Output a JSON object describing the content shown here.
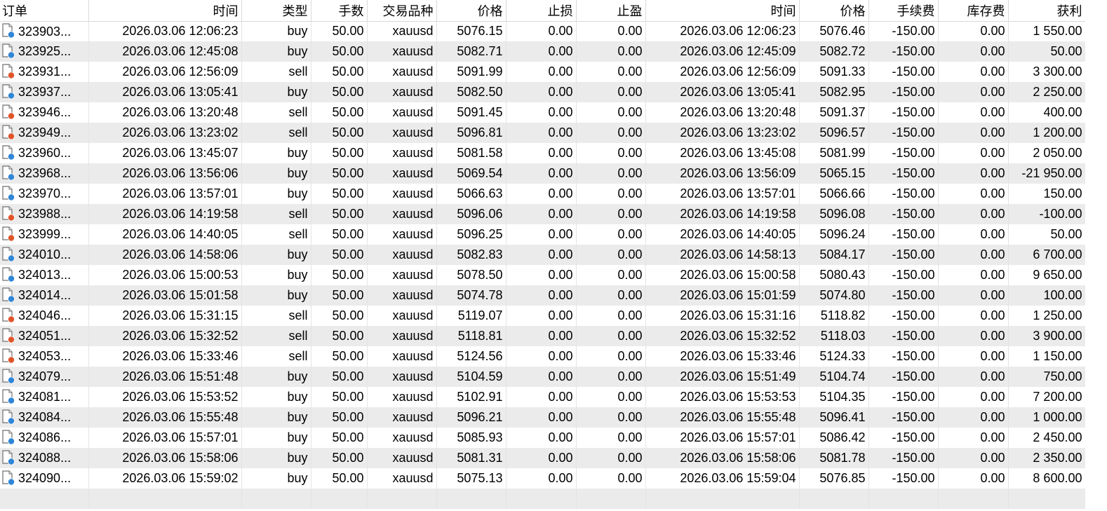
{
  "columns": {
    "ticket": "订单",
    "open_time": "时间",
    "type": "类型",
    "volume": "手数",
    "symbol": "交易品种",
    "open_price": "价格",
    "sl": "止损",
    "tp": "止盈",
    "close_time": "时间",
    "close_price": "价格",
    "commission": "手续费",
    "swap": "库存费",
    "profit": "获利"
  },
  "icon_colors": {
    "buy": "#2f86d6",
    "sell": "#e0552b"
  },
  "rows": [
    {
      "ticket": "323903...",
      "open_time": "2026.03.06 12:06:23",
      "type": "buy",
      "volume": "50.00",
      "symbol": "xauusd",
      "open_price": "5076.15",
      "sl": "0.00",
      "tp": "0.00",
      "close_time": "2026.03.06 12:06:23",
      "close_price": "5076.46",
      "commission": "-150.00",
      "swap": "0.00",
      "profit": "1 550.00"
    },
    {
      "ticket": "323925...",
      "open_time": "2026.03.06 12:45:08",
      "type": "buy",
      "volume": "50.00",
      "symbol": "xauusd",
      "open_price": "5082.71",
      "sl": "0.00",
      "tp": "0.00",
      "close_time": "2026.03.06 12:45:09",
      "close_price": "5082.72",
      "commission": "-150.00",
      "swap": "0.00",
      "profit": "50.00"
    },
    {
      "ticket": "323931...",
      "open_time": "2026.03.06 12:56:09",
      "type": "sell",
      "volume": "50.00",
      "symbol": "xauusd",
      "open_price": "5091.99",
      "sl": "0.00",
      "tp": "0.00",
      "close_time": "2026.03.06 12:56:09",
      "close_price": "5091.33",
      "commission": "-150.00",
      "swap": "0.00",
      "profit": "3 300.00"
    },
    {
      "ticket": "323937...",
      "open_time": "2026.03.06 13:05:41",
      "type": "buy",
      "volume": "50.00",
      "symbol": "xauusd",
      "open_price": "5082.50",
      "sl": "0.00",
      "tp": "0.00",
      "close_time": "2026.03.06 13:05:41",
      "close_price": "5082.95",
      "commission": "-150.00",
      "swap": "0.00",
      "profit": "2 250.00"
    },
    {
      "ticket": "323946...",
      "open_time": "2026.03.06 13:20:48",
      "type": "sell",
      "volume": "50.00",
      "symbol": "xauusd",
      "open_price": "5091.45",
      "sl": "0.00",
      "tp": "0.00",
      "close_time": "2026.03.06 13:20:48",
      "close_price": "5091.37",
      "commission": "-150.00",
      "swap": "0.00",
      "profit": "400.00"
    },
    {
      "ticket": "323949...",
      "open_time": "2026.03.06 13:23:02",
      "type": "sell",
      "volume": "50.00",
      "symbol": "xauusd",
      "open_price": "5096.81",
      "sl": "0.00",
      "tp": "0.00",
      "close_time": "2026.03.06 13:23:02",
      "close_price": "5096.57",
      "commission": "-150.00",
      "swap": "0.00",
      "profit": "1 200.00"
    },
    {
      "ticket": "323960...",
      "open_time": "2026.03.06 13:45:07",
      "type": "buy",
      "volume": "50.00",
      "symbol": "xauusd",
      "open_price": "5081.58",
      "sl": "0.00",
      "tp": "0.00",
      "close_time": "2026.03.06 13:45:08",
      "close_price": "5081.99",
      "commission": "-150.00",
      "swap": "0.00",
      "profit": "2 050.00"
    },
    {
      "ticket": "323968...",
      "open_time": "2026.03.06 13:56:06",
      "type": "buy",
      "volume": "50.00",
      "symbol": "xauusd",
      "open_price": "5069.54",
      "sl": "0.00",
      "tp": "0.00",
      "close_time": "2026.03.06 13:56:09",
      "close_price": "5065.15",
      "commission": "-150.00",
      "swap": "0.00",
      "profit": "-21 950.00"
    },
    {
      "ticket": "323970...",
      "open_time": "2026.03.06 13:57:01",
      "type": "buy",
      "volume": "50.00",
      "symbol": "xauusd",
      "open_price": "5066.63",
      "sl": "0.00",
      "tp": "0.00",
      "close_time": "2026.03.06 13:57:01",
      "close_price": "5066.66",
      "commission": "-150.00",
      "swap": "0.00",
      "profit": "150.00"
    },
    {
      "ticket": "323988...",
      "open_time": "2026.03.06 14:19:58",
      "type": "sell",
      "volume": "50.00",
      "symbol": "xauusd",
      "open_price": "5096.06",
      "sl": "0.00",
      "tp": "0.00",
      "close_time": "2026.03.06 14:19:58",
      "close_price": "5096.08",
      "commission": "-150.00",
      "swap": "0.00",
      "profit": "-100.00"
    },
    {
      "ticket": "323999...",
      "open_time": "2026.03.06 14:40:05",
      "type": "sell",
      "volume": "50.00",
      "symbol": "xauusd",
      "open_price": "5096.25",
      "sl": "0.00",
      "tp": "0.00",
      "close_time": "2026.03.06 14:40:05",
      "close_price": "5096.24",
      "commission": "-150.00",
      "swap": "0.00",
      "profit": "50.00"
    },
    {
      "ticket": "324010...",
      "open_time": "2026.03.06 14:58:06",
      "type": "buy",
      "volume": "50.00",
      "symbol": "xauusd",
      "open_price": "5082.83",
      "sl": "0.00",
      "tp": "0.00",
      "close_time": "2026.03.06 14:58:13",
      "close_price": "5084.17",
      "commission": "-150.00",
      "swap": "0.00",
      "profit": "6 700.00"
    },
    {
      "ticket": "324013...",
      "open_time": "2026.03.06 15:00:53",
      "type": "buy",
      "volume": "50.00",
      "symbol": "xauusd",
      "open_price": "5078.50",
      "sl": "0.00",
      "tp": "0.00",
      "close_time": "2026.03.06 15:00:58",
      "close_price": "5080.43",
      "commission": "-150.00",
      "swap": "0.00",
      "profit": "9 650.00"
    },
    {
      "ticket": "324014...",
      "open_time": "2026.03.06 15:01:58",
      "type": "buy",
      "volume": "50.00",
      "symbol": "xauusd",
      "open_price": "5074.78",
      "sl": "0.00",
      "tp": "0.00",
      "close_time": "2026.03.06 15:01:59",
      "close_price": "5074.80",
      "commission": "-150.00",
      "swap": "0.00",
      "profit": "100.00"
    },
    {
      "ticket": "324046...",
      "open_time": "2026.03.06 15:31:15",
      "type": "sell",
      "volume": "50.00",
      "symbol": "xauusd",
      "open_price": "5119.07",
      "sl": "0.00",
      "tp": "0.00",
      "close_time": "2026.03.06 15:31:16",
      "close_price": "5118.82",
      "commission": "-150.00",
      "swap": "0.00",
      "profit": "1 250.00"
    },
    {
      "ticket": "324051...",
      "open_time": "2026.03.06 15:32:52",
      "type": "sell",
      "volume": "50.00",
      "symbol": "xauusd",
      "open_price": "5118.81",
      "sl": "0.00",
      "tp": "0.00",
      "close_time": "2026.03.06 15:32:52",
      "close_price": "5118.03",
      "commission": "-150.00",
      "swap": "0.00",
      "profit": "3 900.00"
    },
    {
      "ticket": "324053...",
      "open_time": "2026.03.06 15:33:46",
      "type": "sell",
      "volume": "50.00",
      "symbol": "xauusd",
      "open_price": "5124.56",
      "sl": "0.00",
      "tp": "0.00",
      "close_time": "2026.03.06 15:33:46",
      "close_price": "5124.33",
      "commission": "-150.00",
      "swap": "0.00",
      "profit": "1 150.00"
    },
    {
      "ticket": "324079...",
      "open_time": "2026.03.06 15:51:48",
      "type": "buy",
      "volume": "50.00",
      "symbol": "xauusd",
      "open_price": "5104.59",
      "sl": "0.00",
      "tp": "0.00",
      "close_time": "2026.03.06 15:51:49",
      "close_price": "5104.74",
      "commission": "-150.00",
      "swap": "0.00",
      "profit": "750.00"
    },
    {
      "ticket": "324081...",
      "open_time": "2026.03.06 15:53:52",
      "type": "buy",
      "volume": "50.00",
      "symbol": "xauusd",
      "open_price": "5102.91",
      "sl": "0.00",
      "tp": "0.00",
      "close_time": "2026.03.06 15:53:53",
      "close_price": "5104.35",
      "commission": "-150.00",
      "swap": "0.00",
      "profit": "7 200.00"
    },
    {
      "ticket": "324084...",
      "open_time": "2026.03.06 15:55:48",
      "type": "buy",
      "volume": "50.00",
      "symbol": "xauusd",
      "open_price": "5096.21",
      "sl": "0.00",
      "tp": "0.00",
      "close_time": "2026.03.06 15:55:48",
      "close_price": "5096.41",
      "commission": "-150.00",
      "swap": "0.00",
      "profit": "1 000.00"
    },
    {
      "ticket": "324086...",
      "open_time": "2026.03.06 15:57:01",
      "type": "buy",
      "volume": "50.00",
      "symbol": "xauusd",
      "open_price": "5085.93",
      "sl": "0.00",
      "tp": "0.00",
      "close_time": "2026.03.06 15:57:01",
      "close_price": "5086.42",
      "commission": "-150.00",
      "swap": "0.00",
      "profit": "2 450.00"
    },
    {
      "ticket": "324088...",
      "open_time": "2026.03.06 15:58:06",
      "type": "buy",
      "volume": "50.00",
      "symbol": "xauusd",
      "open_price": "5081.31",
      "sl": "0.00",
      "tp": "0.00",
      "close_time": "2026.03.06 15:58:06",
      "close_price": "5081.78",
      "commission": "-150.00",
      "swap": "0.00",
      "profit": "2 350.00"
    },
    {
      "ticket": "324090...",
      "open_time": "2026.03.06 15:59:02",
      "type": "buy",
      "volume": "50.00",
      "symbol": "xauusd",
      "open_price": "5075.13",
      "sl": "0.00",
      "tp": "0.00",
      "close_time": "2026.03.06 15:59:04",
      "close_price": "5076.85",
      "commission": "-150.00",
      "swap": "0.00",
      "profit": "8 600.00"
    }
  ]
}
